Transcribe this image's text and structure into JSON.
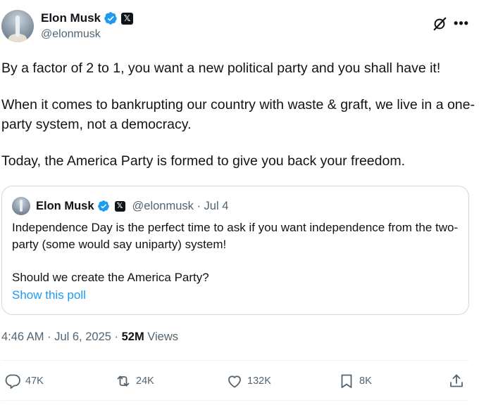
{
  "author": {
    "name": "Elon Musk",
    "handle": "@elonmusk"
  },
  "badges": {
    "verified_color": "#1d9bf0",
    "x_badge": "𝕏"
  },
  "header_icons": [
    "grok-icon",
    "more-icon"
  ],
  "tweet": {
    "paragraphs": [
      "By a factor of 2 to 1, you want a new political party and you shall have it!",
      "When it comes to bankrupting our country with waste & graft, we live in a one-party system, not a democracy.",
      "Today, the America Party is formed to give you back your freedom."
    ]
  },
  "quote": {
    "name": "Elon Musk",
    "meta": "@elonmusk · Jul 4",
    "paragraphs": [
      "Independence Day is the perfect time to ask if you want independence from the two-party (some would say uniparty) system!",
      "Should we create the America Party?"
    ],
    "poll_link": "Show this poll"
  },
  "meta": {
    "time": "4:46 AM · Jul 6, 2025 · ",
    "views_count": "52M",
    "views_label": " Views"
  },
  "actions": {
    "replies": "47K",
    "reposts": "24K",
    "likes": "132K",
    "bookmarks": "8K"
  },
  "colors": {
    "accent": "#1d9bf0",
    "text": "#0f1419",
    "muted": "#536471",
    "border": "#cfd9de"
  }
}
